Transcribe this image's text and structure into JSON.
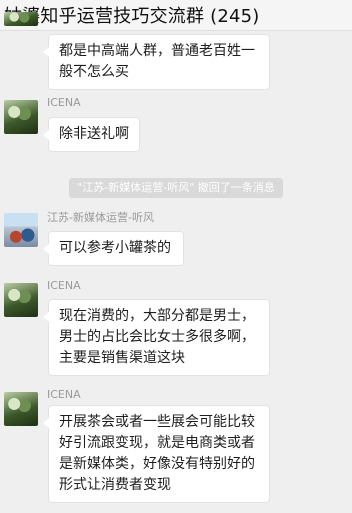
{
  "header": {
    "title": "姑婆知乎运营技巧交流群 (245)"
  },
  "messages": [
    {
      "sender": "",
      "lines": [
        "都是中高端人群，普通老百姓一",
        "般不怎么买"
      ]
    },
    {
      "sender": "ICENA",
      "lines": [
        "除非送礼啊"
      ]
    },
    {
      "sender": "江苏-新媒体运营-听风",
      "lines": [
        "可以参考小罐茶的"
      ]
    },
    {
      "sender": "ICENA",
      "lines": [
        "现在消费的，大部分都是男士，",
        "男士的占比会比女士多很多啊，",
        "主要是销售渠道这块"
      ]
    },
    {
      "sender": "ICENA",
      "lines": [
        "开展茶会或者一些展会可能比较",
        "好引流跟变现，就是电商类或者",
        "是新媒体类，好像没有特别好的",
        "形式让消费者变现"
      ]
    }
  ],
  "system_notice": "\"江苏-新媒体运营-听风\" 撤回了一条消息",
  "avatars": [
    "plant-avatar",
    "plant-avatar",
    "chair-avatar",
    "plant-avatar",
    "plant-avatar"
  ]
}
